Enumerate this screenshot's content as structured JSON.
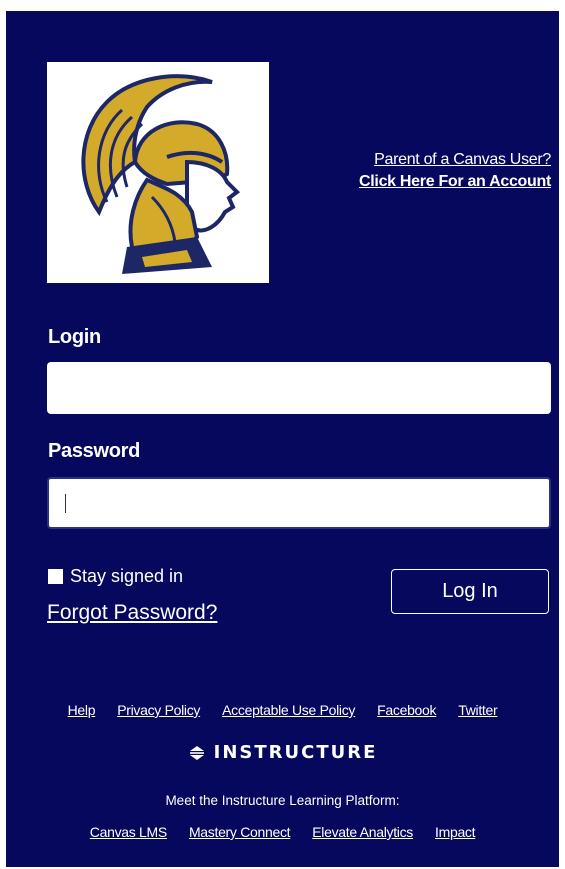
{
  "header": {
    "parent_link_line1": "Parent of a Canvas User?",
    "parent_link_line2": "Click Here For an Account"
  },
  "logo": {
    "icon": "trojan-helmet-logo",
    "colors": {
      "gold": "#d4aa2a",
      "navy": "#1d2766"
    }
  },
  "form": {
    "login_label": "Login",
    "login_value": "",
    "password_label": "Password",
    "password_value": "",
    "remember_label": "Stay signed in",
    "remember_checked": false,
    "forgot_link": "Forgot Password?",
    "submit_label": "Log In"
  },
  "footer": {
    "links": [
      "Help",
      "Privacy Policy",
      "Acceptable Use Policy",
      "Facebook",
      "Twitter"
    ],
    "brand": "INSTRUCTURE",
    "tagline": "Meet the Instructure Learning Platform:",
    "platform_links": [
      "Canvas LMS",
      "Mastery Connect",
      "Elevate Analytics",
      "Impact"
    ]
  },
  "colors": {
    "panel_bg": "#06085e",
    "text": "#ffffff"
  }
}
